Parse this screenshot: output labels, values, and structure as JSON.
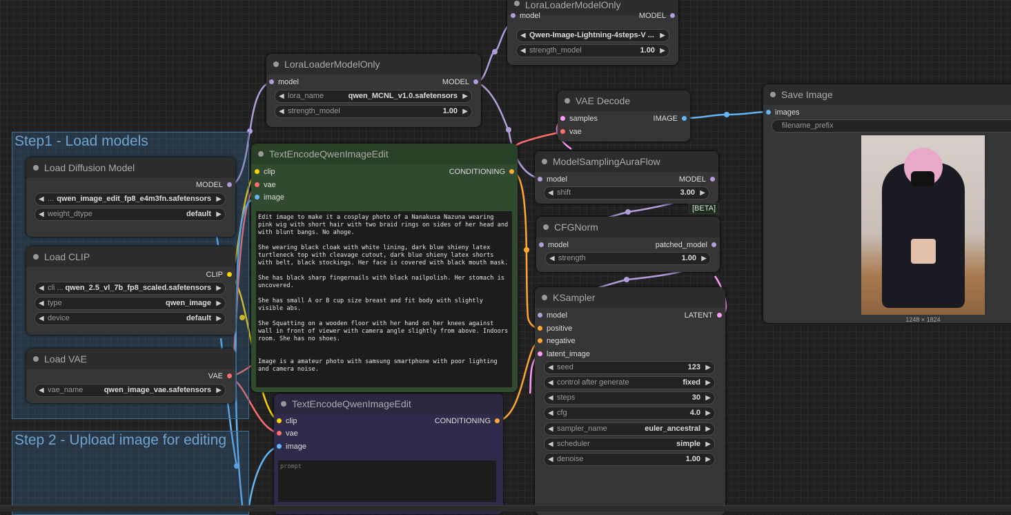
{
  "groups": {
    "step1": "Step1 - Load models",
    "step2": "Step 2 - Upload image for editing"
  },
  "nodes": {
    "lora_top": {
      "title": "LoraLoaderModelOnly",
      "in_model": "model",
      "out_model": "MODEL",
      "lora_value": "Qwen-Image-Lightning-4steps-V ...",
      "strength_label": "strength_model",
      "strength_value": "1.00"
    },
    "lora_mid": {
      "title": "LoraLoaderModelOnly",
      "in_model": "model",
      "out_model": "MODEL",
      "lora_label": "lora_name",
      "lora_value": "qwen_MCNL_v1.0.safetensors",
      "strength_label": "strength_model",
      "strength_value": "1.00"
    },
    "vae_decode": {
      "title": "VAE Decode",
      "in_samples": "samples",
      "in_vae": "vae",
      "out_image": "IMAGE"
    },
    "save_image": {
      "title": "Save Image",
      "in_images": "images",
      "prefix_label": "filename_prefix",
      "image_size": "1248 × 1824"
    },
    "load_diffusion": {
      "title": "Load Diffusion Model",
      "out_model": "MODEL",
      "unet_label": "...",
      "unet_value": "qwen_image_edit_fp8_e4m3fn.safetensors",
      "dtype_label": "weight_dtype",
      "dtype_value": "default"
    },
    "load_clip": {
      "title": "Load CLIP",
      "out_clip": "CLIP",
      "clip_label": "cli ...",
      "clip_value": "qwen_2.5_vl_7b_fp8_scaled.safetensors",
      "type_label": "type",
      "type_value": "qwen_image",
      "device_label": "device",
      "device_value": "default"
    },
    "load_vae": {
      "title": "Load VAE",
      "out_vae": "VAE",
      "vae_label": "vae_name",
      "vae_value": "qwen_image_vae.safetensors"
    },
    "text_pos": {
      "title": "TextEncodeQwenImageEdit",
      "in_clip": "clip",
      "in_vae": "vae",
      "in_image": "image",
      "out_cond": "CONDITIONING",
      "prompt": "Edit image to make it a cosplay photo of a Nanakusa Nazuna wearing pink wig with short hair with two braid rings on sides of her head and with blunt bangs. No ahoge.\n\nShe wearing black cloak with white lining, dark blue shieny latex turtleneck top with cleavage cutout, dark blue shieny latex shorts with belt, black stockings. Her face is covered with black mouth mask.\n\nShe has black sharp fingernails with black nailpolish. Her stomach is uncovered.\n\nShe has small A or B cup size breast and fit body with slightly visible abs.\n\nShe Squatting on a wooden floor with her hand on her knees against wall in front of viewer with camera angle slightly from above. Indoors room. She has no shoes.\n\n\nImage is a amateur photo with samsung smartphone with poor lighting and camera noise."
    },
    "text_neg": {
      "title": "TextEncodeQwenImageEdit",
      "in_clip": "clip",
      "in_vae": "vae",
      "in_image": "image",
      "out_cond": "CONDITIONING",
      "placeholder": "prompt"
    },
    "aura": {
      "title": "ModelSamplingAuraFlow",
      "in_model": "model",
      "out_model": "MODEL",
      "shift_label": "shift",
      "shift_value": "3.00",
      "badge": "[BETA]"
    },
    "cfgnorm": {
      "title": "CFGNorm",
      "in_model": "model",
      "out_model": "patched_model",
      "strength_label": "strength",
      "strength_value": "1.00"
    },
    "ksampler": {
      "title": "KSampler",
      "in_model": "model",
      "in_positive": "positive",
      "in_negative": "negative",
      "in_latent": "latent_image",
      "out_latent": "LATENT",
      "widgets": [
        {
          "label": "seed",
          "value": "123"
        },
        {
          "label": "control after generate",
          "value": "fixed"
        },
        {
          "label": "steps",
          "value": "30"
        },
        {
          "label": "cfg",
          "value": "4.0"
        },
        {
          "label": "sampler_name",
          "value": "euler_ancestral"
        },
        {
          "label": "scheduler",
          "value": "simple"
        },
        {
          "label": "denoise",
          "value": "1.00"
        }
      ]
    }
  },
  "colors": {
    "model": "#b39ddb",
    "clip": "#ffd500",
    "vae": "#ff6e6e",
    "image": "#64b5f6",
    "conditioning": "#ffa931",
    "latent": "#ff9cf9"
  },
  "icons": {
    "left_arrow": "◀",
    "right_arrow": "▶"
  }
}
